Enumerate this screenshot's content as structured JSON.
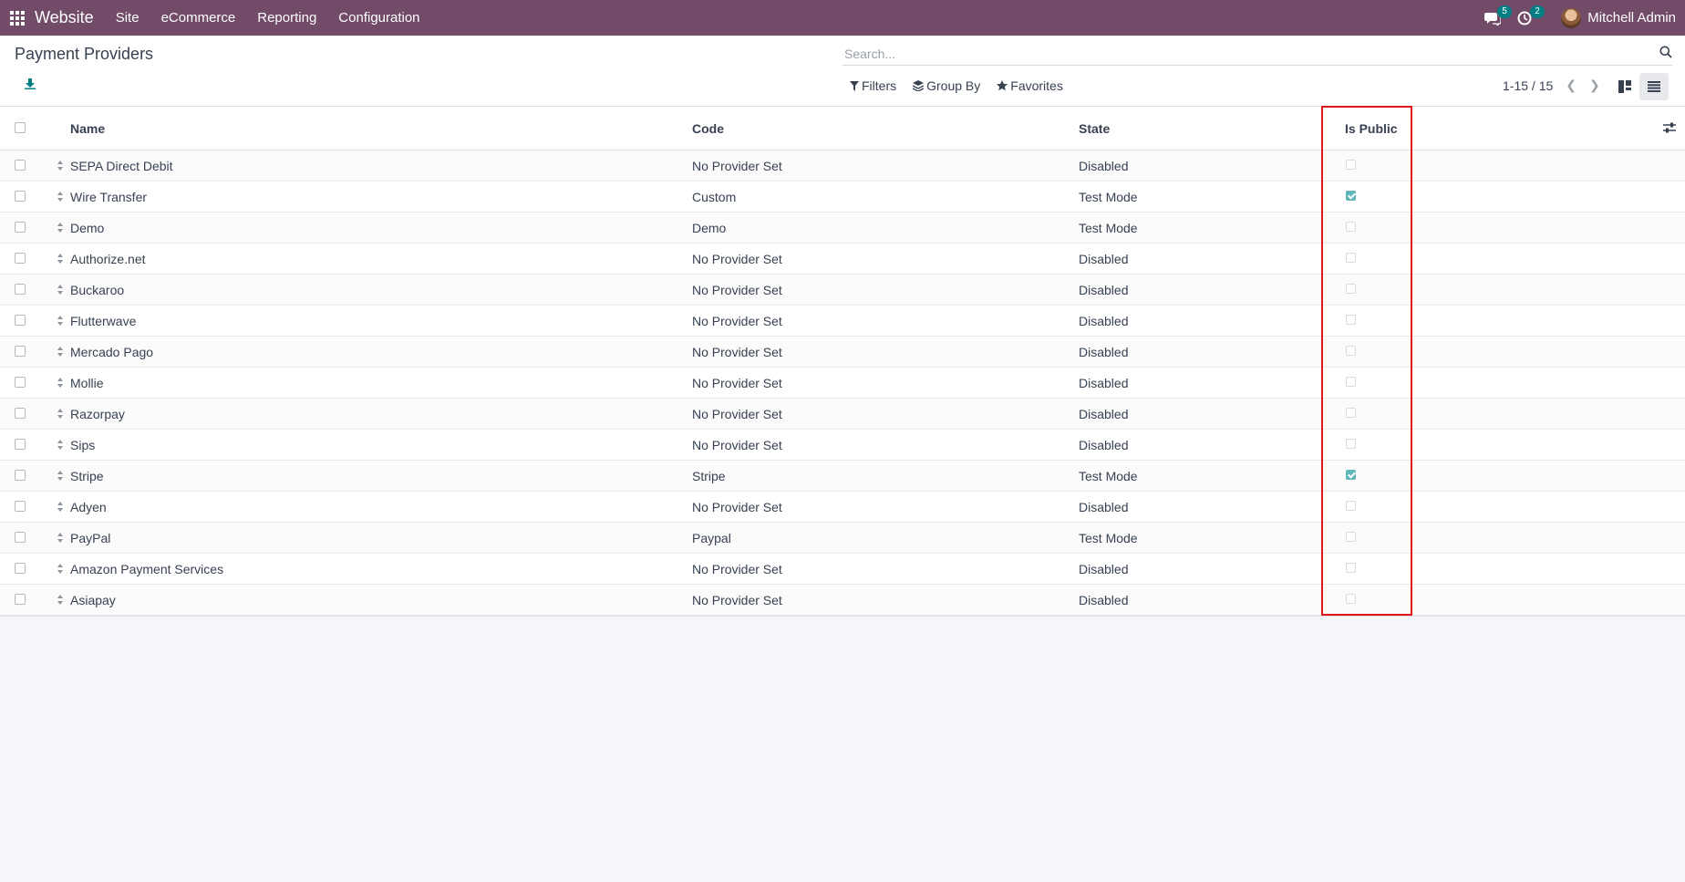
{
  "navbar": {
    "app_name": "Website",
    "menu": [
      "Site",
      "eCommerce",
      "Reporting",
      "Configuration"
    ],
    "messages_count": "5",
    "activities_count": "2",
    "user_name": "Mitchell Admin"
  },
  "control": {
    "title": "Payment Providers",
    "search_placeholder": "Search...",
    "filters_label": "Filters",
    "groupby_label": "Group By",
    "favorites_label": "Favorites",
    "pager": "1-15 / 15"
  },
  "table": {
    "headers": {
      "name": "Name",
      "code": "Code",
      "state": "State",
      "is_public": "Is Public"
    },
    "rows": [
      {
        "name": "SEPA Direct Debit",
        "code": "No Provider Set",
        "state": "Disabled",
        "is_public": false
      },
      {
        "name": "Wire Transfer",
        "code": "Custom",
        "state": "Test Mode",
        "is_public": true
      },
      {
        "name": "Demo",
        "code": "Demo",
        "state": "Test Mode",
        "is_public": false
      },
      {
        "name": "Authorize.net",
        "code": "No Provider Set",
        "state": "Disabled",
        "is_public": false
      },
      {
        "name": "Buckaroo",
        "code": "No Provider Set",
        "state": "Disabled",
        "is_public": false
      },
      {
        "name": "Flutterwave",
        "code": "No Provider Set",
        "state": "Disabled",
        "is_public": false
      },
      {
        "name": "Mercado Pago",
        "code": "No Provider Set",
        "state": "Disabled",
        "is_public": false
      },
      {
        "name": "Mollie",
        "code": "No Provider Set",
        "state": "Disabled",
        "is_public": false
      },
      {
        "name": "Razorpay",
        "code": "No Provider Set",
        "state": "Disabled",
        "is_public": false
      },
      {
        "name": "Sips",
        "code": "No Provider Set",
        "state": "Disabled",
        "is_public": false
      },
      {
        "name": "Stripe",
        "code": "Stripe",
        "state": "Test Mode",
        "is_public": true
      },
      {
        "name": "Adyen",
        "code": "No Provider Set",
        "state": "Disabled",
        "is_public": false
      },
      {
        "name": "PayPal",
        "code": "Paypal",
        "state": "Test Mode",
        "is_public": false
      },
      {
        "name": "Amazon Payment Services",
        "code": "No Provider Set",
        "state": "Disabled",
        "is_public": false
      },
      {
        "name": "Asiapay",
        "code": "No Provider Set",
        "state": "Disabled",
        "is_public": false
      }
    ]
  },
  "colors": {
    "navbar": "#714b67",
    "accent": "#017e84",
    "highlight": "#e0161b"
  }
}
